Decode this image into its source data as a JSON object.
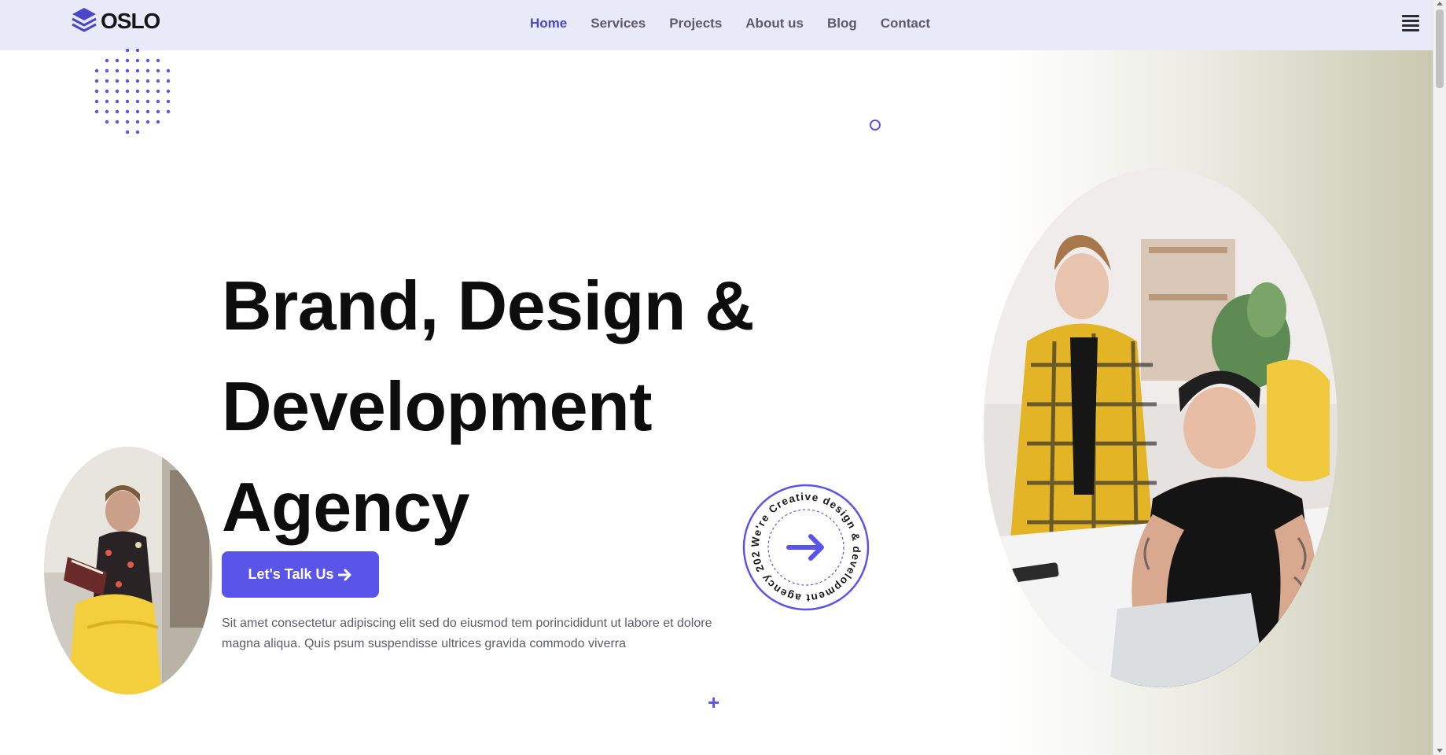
{
  "brand": {
    "name": "OSLO",
    "accent_color": "#5a54e8"
  },
  "nav": {
    "items": [
      {
        "label": "Home",
        "active": true
      },
      {
        "label": "Services",
        "active": false
      },
      {
        "label": "Projects",
        "active": false
      },
      {
        "label": "About us",
        "active": false
      },
      {
        "label": "Blog",
        "active": false
      },
      {
        "label": "Contact",
        "active": false
      }
    ],
    "menu_icon": "hamburger-icon"
  },
  "hero": {
    "title_lines": [
      "Brand, Design &",
      "Development",
      "Agency"
    ],
    "cta_label": "Let's Talk Us",
    "cta_icon": "arrow-right-icon",
    "description": "Sit amet consectetur adipiscing elit sed do eiusmod tem porincididunt ut labore et dolore magna aliqua. Quis psum suspendisse ultrices gravida commodo viverra"
  },
  "badge": {
    "circular_text": "We're Creative design & development agency 2022",
    "icon": "arrow-right-icon"
  },
  "decor": {
    "dots_icon": "dot-grid-decoration",
    "ring_icon": "ring-decoration",
    "plus_icon": "plus-decoration"
  },
  "images": {
    "left": "man-reading-with-headphones-photo",
    "right": "two-people-working-at-laptop-photo"
  }
}
